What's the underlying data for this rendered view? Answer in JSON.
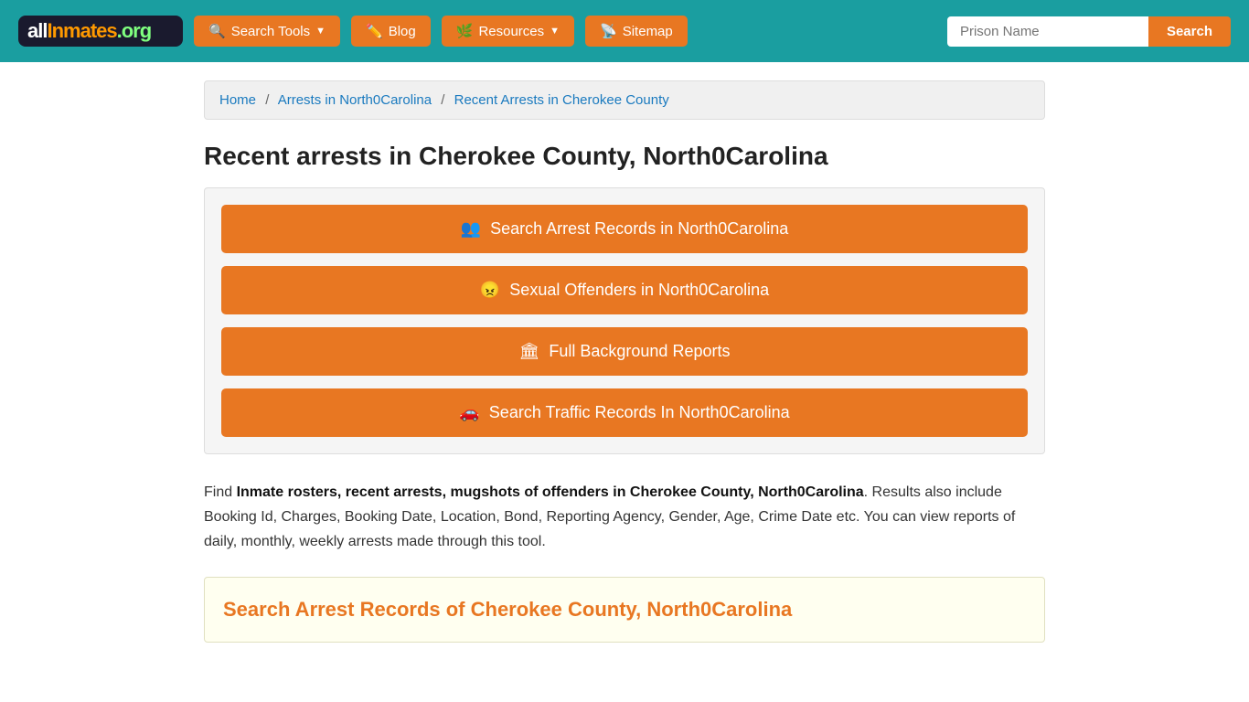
{
  "header": {
    "logo_text_all": "all",
    "logo_text_inmates": "Inmates",
    "logo_text_org": ".org",
    "nav_items": [
      {
        "label": "Search Tools",
        "icon": "🔍",
        "has_dropdown": true,
        "id": "search-tools"
      },
      {
        "label": "Blog",
        "icon": "✏️",
        "has_dropdown": false,
        "id": "blog"
      },
      {
        "label": "Resources",
        "icon": "🌿",
        "has_dropdown": true,
        "id": "resources"
      },
      {
        "label": "Sitemap",
        "icon": "📡",
        "has_dropdown": false,
        "id": "sitemap"
      }
    ],
    "search_placeholder": "Prison Name",
    "search_button_label": "Search"
  },
  "breadcrumb": {
    "items": [
      {
        "label": "Home",
        "href": "#"
      },
      {
        "label": "Arrests in North0Carolina",
        "href": "#"
      },
      {
        "label": "Recent Arrests in Cherokee County",
        "href": "#"
      }
    ]
  },
  "page_title": "Recent arrests in Cherokee County, North0Carolina",
  "action_buttons": [
    {
      "label": "Search Arrest Records in North0Carolina",
      "icon": "👥",
      "id": "arrest-records"
    },
    {
      "label": "Sexual Offenders in North0Carolina",
      "icon": "😠",
      "id": "sexual-offenders"
    },
    {
      "label": "Full Background Reports",
      "icon": "🏛",
      "id": "background-reports"
    },
    {
      "label": "Search Traffic Records In North0Carolina",
      "icon": "🚗",
      "id": "traffic-records"
    }
  ],
  "description": {
    "prefix": "Find ",
    "bold_text": "Inmate rosters, recent arrests, mugshots of offenders in Cherokee County, North0Carolina",
    "suffix": ". Results also include Booking Id, Charges, Booking Date, Location, Bond, Reporting Agency, Gender, Age, Crime Date etc. You can view reports of daily, monthly, weekly arrests made through this tool."
  },
  "bottom_section": {
    "title": "Search Arrest Records of Cherokee County, North0Carolina"
  }
}
